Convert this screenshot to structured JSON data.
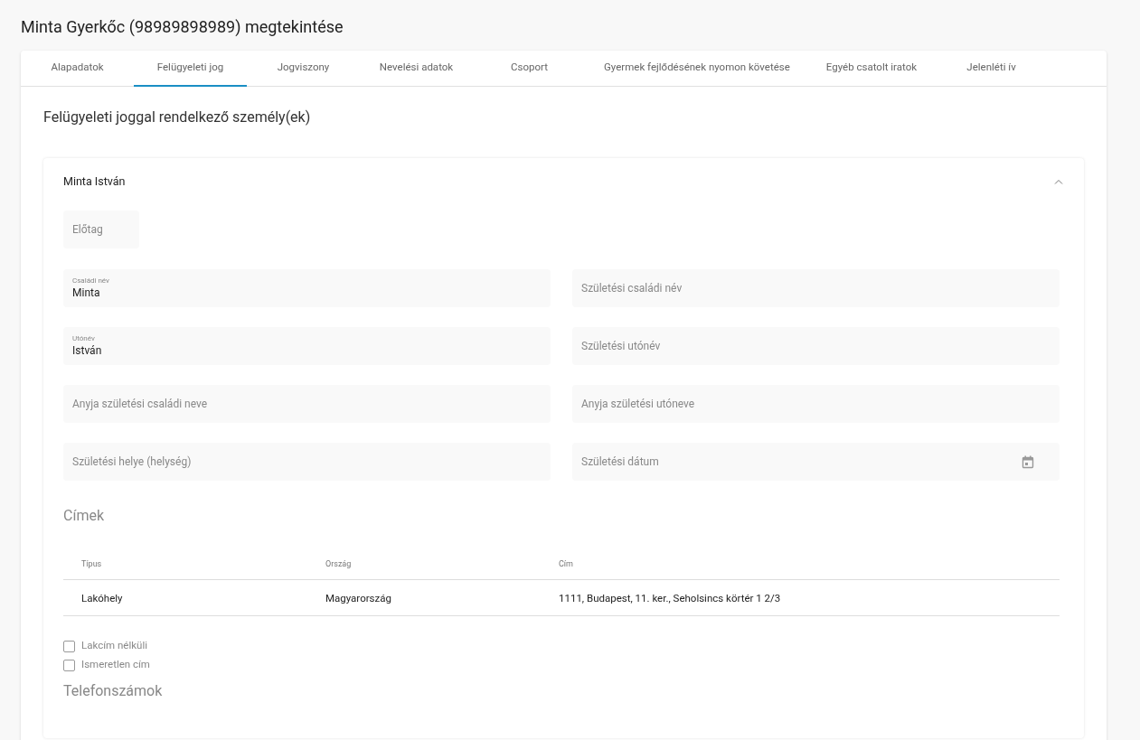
{
  "page_title": "Minta Gyerkőc (98989898989) megtekintése",
  "tabs": [
    {
      "label": "Alapadatok",
      "selected": false
    },
    {
      "label": "Felügyeleti jog",
      "selected": true
    },
    {
      "label": "Jogviszony",
      "selected": false
    },
    {
      "label": "Nevelési adatok",
      "selected": false
    },
    {
      "label": "Csoport",
      "selected": false
    },
    {
      "label": "Gyermek fejlődésének nyomon követése",
      "selected": false
    },
    {
      "label": "Egyéb csatolt iratok",
      "selected": false
    },
    {
      "label": "Jelenléti ív",
      "selected": false
    }
  ],
  "section_title": "Felügyeleti joggal rendelkező személy(ek)",
  "person": {
    "name": "Minta István",
    "expanded": true,
    "prefix_field": {
      "placeholder": "Előtag"
    },
    "fields": [
      {
        "kind": "text",
        "label": "Családi név",
        "value": "Minta"
      },
      {
        "kind": "text",
        "placeholder": "Születési családi név"
      },
      {
        "kind": "text",
        "label": "Utónév",
        "value": "István"
      },
      {
        "kind": "text",
        "placeholder": "Születési utónév"
      },
      {
        "kind": "text",
        "placeholder": "Anyja születési családi neve"
      },
      {
        "kind": "text",
        "placeholder": "Anyja születési utóneve"
      },
      {
        "kind": "text",
        "placeholder": "Születési helye (helység)"
      },
      {
        "kind": "date",
        "placeholder": "Születési dátum"
      }
    ],
    "addresses_title": "Címek",
    "table": {
      "columns": [
        "Típus",
        "Ország",
        "Cím"
      ],
      "rows": [
        [
          "Lakóhely",
          "Magyarország",
          "1111, Budapest, 11. ker., Seholsincs körtér 1 2/3"
        ]
      ]
    },
    "checkboxes": [
      {
        "label": "Lakcím nélküli",
        "checked": false
      },
      {
        "label": "Ismeretlen cím",
        "checked": false
      }
    ],
    "phones_title": "Telefonszámok"
  }
}
